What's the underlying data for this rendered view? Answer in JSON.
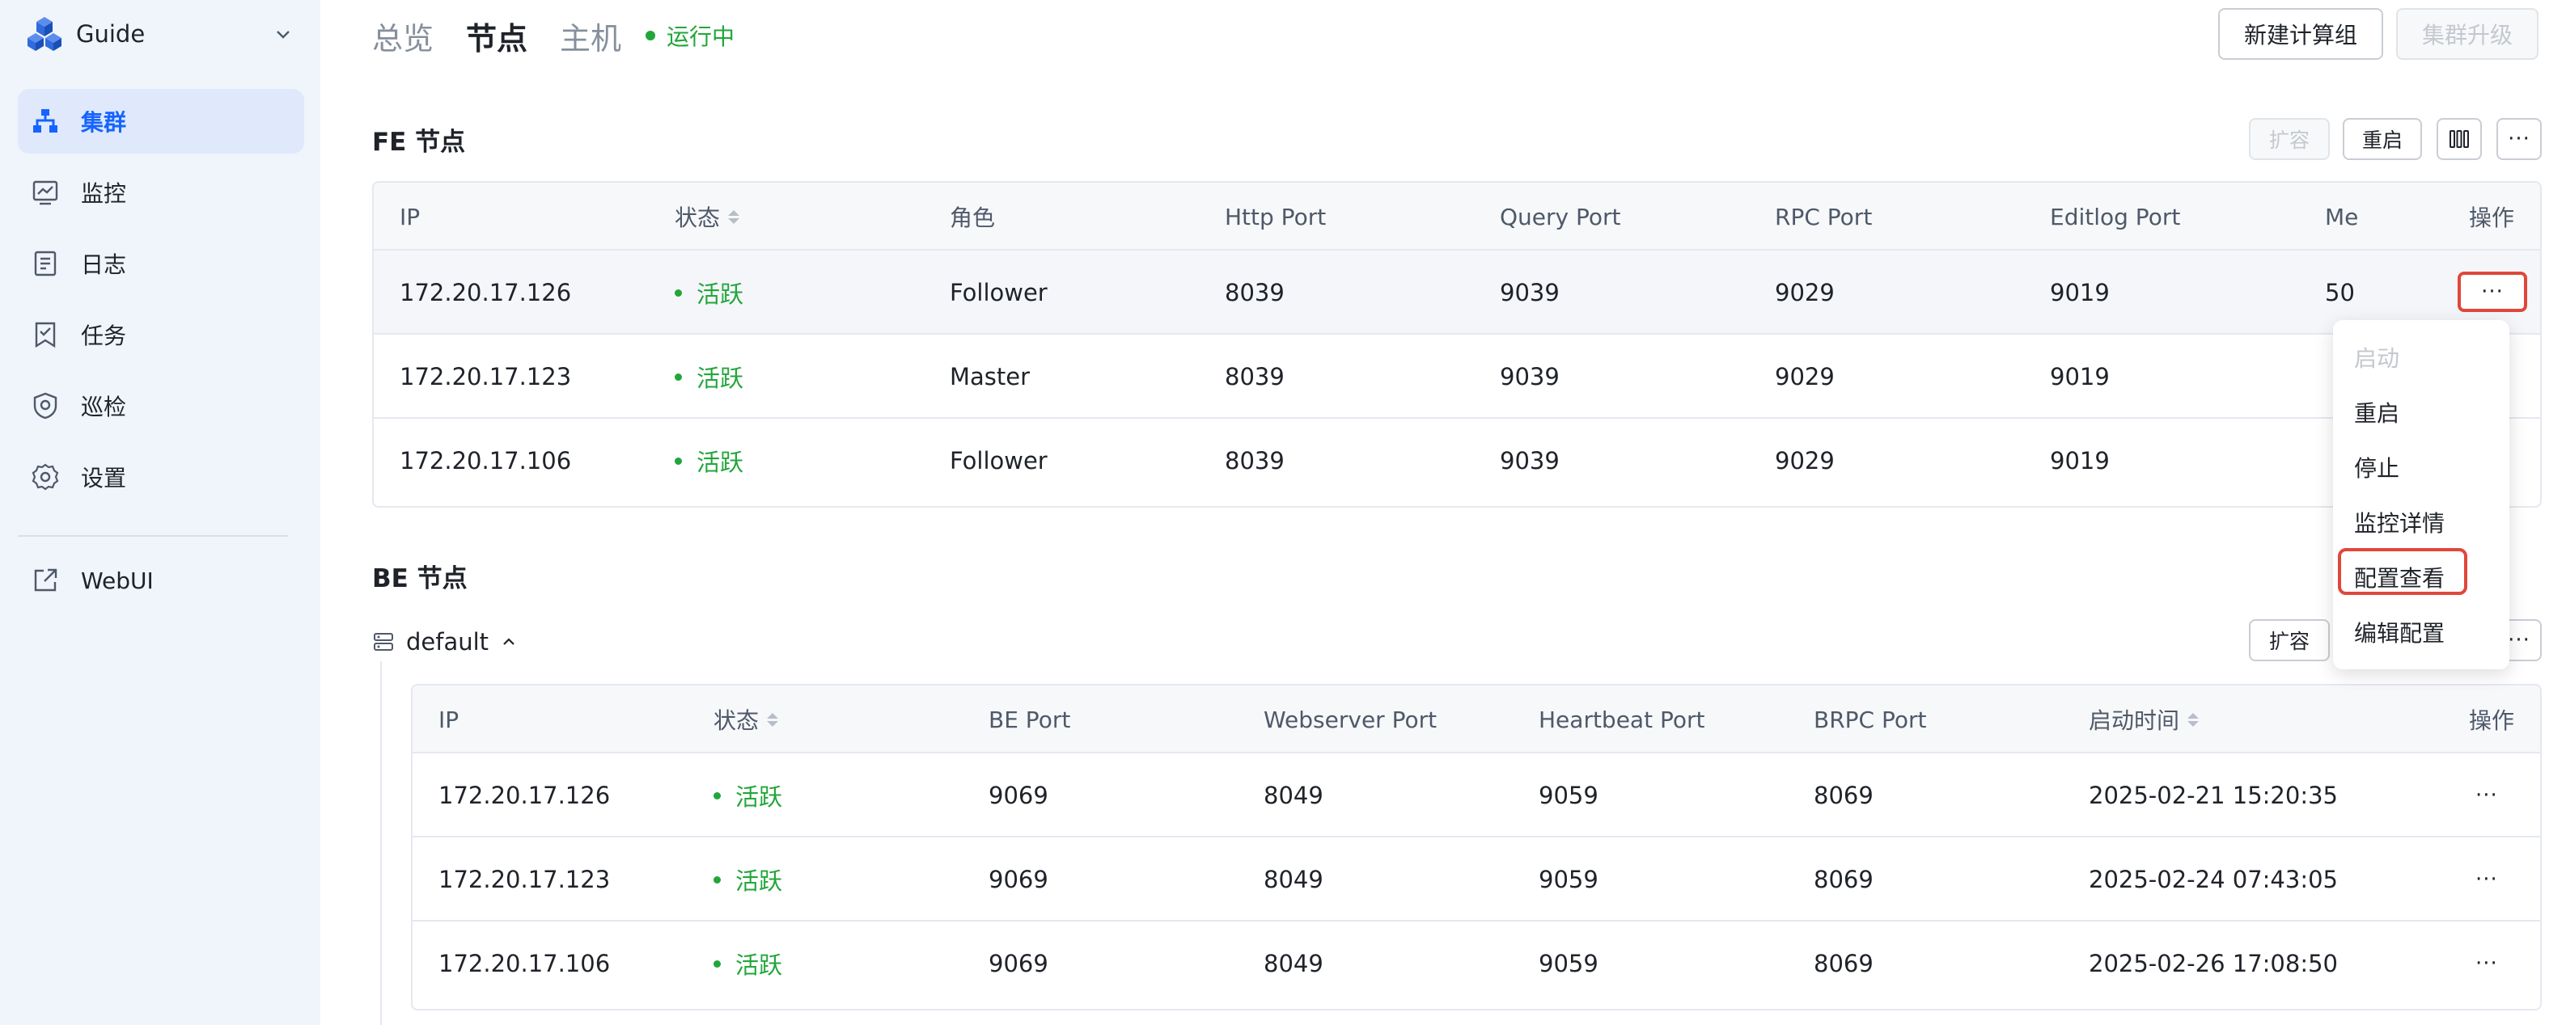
{
  "sidebar": {
    "brand": "Guide",
    "items": [
      {
        "label": "集群",
        "icon": "cluster-icon",
        "active": true
      },
      {
        "label": "监控",
        "icon": "monitor-icon"
      },
      {
        "label": "日志",
        "icon": "log-icon"
      },
      {
        "label": "任务",
        "icon": "task-icon"
      },
      {
        "label": "巡检",
        "icon": "inspection-icon"
      },
      {
        "label": "设置",
        "icon": "gear-icon"
      },
      {
        "label": "WebUI",
        "icon": "external-link-icon"
      }
    ]
  },
  "header": {
    "tabs": [
      "总览",
      "节点",
      "主机"
    ],
    "active_tab": "节点",
    "status": "运行中",
    "buttons": {
      "new_group": "新建计算组",
      "upgrade": "集群升级"
    }
  },
  "fe": {
    "title": "FE 节点",
    "actions": {
      "expand": "扩容",
      "restart": "重启"
    },
    "columns": [
      "IP",
      "状态",
      "角色",
      "Http Port",
      "Query Port",
      "RPC Port",
      "Editlog Port",
      "Me",
      "操作"
    ],
    "rows": [
      {
        "ip": "172.20.17.126",
        "status": "活跃",
        "role": "Follower",
        "http": "8039",
        "query": "9039",
        "rpc": "9029",
        "editlog": "9019",
        "me": "50"
      },
      {
        "ip": "172.20.17.123",
        "status": "活跃",
        "role": "Master",
        "http": "8039",
        "query": "9039",
        "rpc": "9029",
        "editlog": "9019",
        "me": ""
      },
      {
        "ip": "172.20.17.106",
        "status": "活跃",
        "role": "Follower",
        "http": "8039",
        "query": "9039",
        "rpc": "9029",
        "editlog": "9019",
        "me": ""
      }
    ]
  },
  "be": {
    "title": "BE 节点",
    "group": "default",
    "actions": {
      "expand": "扩容"
    },
    "columns": [
      "IP",
      "状态",
      "BE Port",
      "Webserver Port",
      "Heartbeat Port",
      "BRPC Port",
      "启动时间",
      "操作"
    ],
    "rows": [
      {
        "ip": "172.20.17.126",
        "status": "活跃",
        "be_port": "9069",
        "web": "8049",
        "hb": "9059",
        "brpc": "8069",
        "start": "2025-02-21 15:20:35"
      },
      {
        "ip": "172.20.17.123",
        "status": "活跃",
        "be_port": "9069",
        "web": "8049",
        "hb": "9059",
        "brpc": "8069",
        "start": "2025-02-24 07:43:05"
      },
      {
        "ip": "172.20.17.106",
        "status": "活跃",
        "be_port": "9069",
        "web": "8049",
        "hb": "9059",
        "brpc": "8069",
        "start": "2025-02-26 17:08:50"
      }
    ]
  },
  "menu": {
    "items": [
      "启动",
      "重启",
      "停止",
      "监控详情",
      "配置查看",
      "编辑配置"
    ],
    "disabled": [
      "启动"
    ],
    "highlighted": "配置查看"
  },
  "colors": {
    "accent": "#1664ff",
    "success": "#22a63a",
    "highlight": "#e0473a"
  }
}
